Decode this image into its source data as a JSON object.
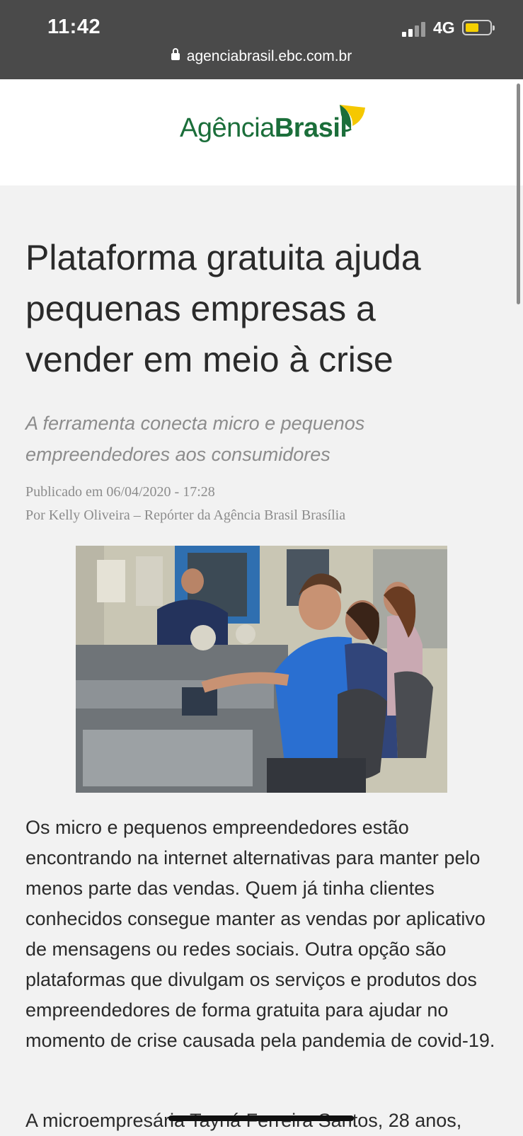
{
  "status_bar": {
    "time": "11:42",
    "network": "4G",
    "url": "agenciabrasil.ebc.com.br"
  },
  "site": {
    "logo_part1": "Agência",
    "logo_part2": "Brasil"
  },
  "article": {
    "headline": "Plataforma gratuita ajuda pequenas empresas a vender em meio à crise",
    "subtitle": "A ferramenta conecta micro e pequenos empreendedores aos consumidores",
    "published": "Publicado em 06/04/2020 - 17:28",
    "byline": "Por Kelly Oliveira – Repórter da Agência Brasil Brasília",
    "paragraph1": "Os micro e pequenos empreendedores estão encontrando na internet alternativas para manter pelo menos parte das vendas. Quem já tinha clientes conhecidos consegue manter as vendas por aplicativo de mensagens ou redes sociais. Outra opção são plataformas que divulgam os serviços e produtos dos empreendedores de forma gratuita para ajudar no momento de crise causada pela pandemia de covid-19.",
    "paragraph2": "A microempresária Tayná Ferreira Santos, 28 anos,"
  },
  "colors": {
    "status_bg": "#4a4a4a",
    "page_bg": "#f2f2f2",
    "logo_green": "#1b6e3a",
    "logo_yellow": "#f5c800",
    "battery": "#f5d000"
  }
}
